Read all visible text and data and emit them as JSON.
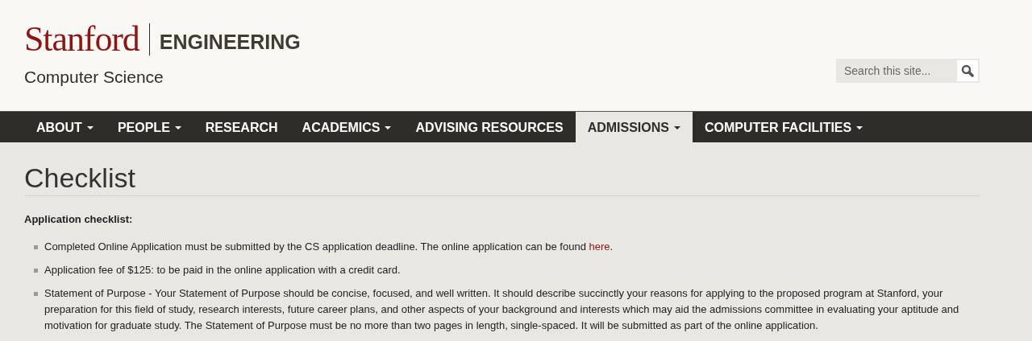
{
  "header": {
    "logo_word": "Stanford",
    "logo_unit": "ENGINEERING",
    "site_name": "Computer Science",
    "search": {
      "placeholder": "Search this site..."
    }
  },
  "nav": [
    {
      "label": "ABOUT",
      "dropdown": true,
      "selected": false
    },
    {
      "label": "PEOPLE",
      "dropdown": true,
      "selected": false
    },
    {
      "label": "RESEARCH",
      "dropdown": false,
      "selected": false
    },
    {
      "label": "ACADEMICS",
      "dropdown": true,
      "selected": false
    },
    {
      "label": "ADVISING RESOURCES",
      "dropdown": false,
      "selected": false
    },
    {
      "label": "ADMISSIONS",
      "dropdown": true,
      "selected": true
    },
    {
      "label": "COMPUTER FACILITIES",
      "dropdown": true,
      "selected": false
    }
  ],
  "page": {
    "title": "Checklist",
    "intro": "Application checklist:",
    "items": [
      {
        "text": "Completed Online Application must be submitted by the CS application deadline. The online application can be found ",
        "link": "here",
        "after": "."
      },
      {
        "text": "Application fee of $125: to be paid in the online application with a credit card."
      },
      {
        "text": "Statement of Purpose - Your Statement of Purpose should be concise, focused, and well written. It should describe succinctly your reasons for applying to the proposed program at Stanford, your preparation for this field of study, research interests, future career plans, and other aspects of your background and interests which may aid the admissions committee in evaluating your aptitude and motivation for graduate study. The Statement of Purpose must be no more than two pages in length, single-spaced. It will be submitted as part of the online application."
      }
    ]
  }
}
